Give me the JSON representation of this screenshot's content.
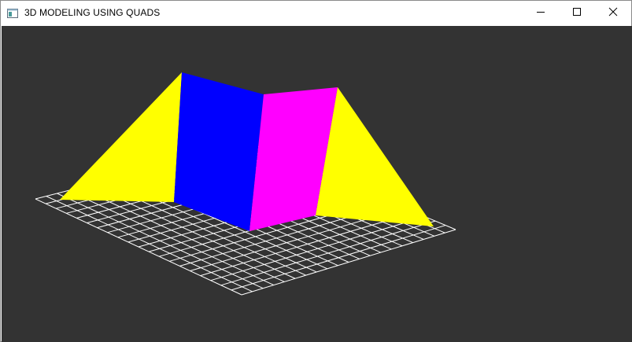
{
  "window": {
    "title": "3D MODELING USING QUADS",
    "icon": "app-window-icon",
    "controls": {
      "minimize": "minimize-icon",
      "maximize": "maximize-icon",
      "close": "close-icon"
    }
  },
  "viewport": {
    "background_color": "#333333",
    "grid": {
      "color": "#ffffff",
      "divisions": 20
    },
    "quads": [
      {
        "name": "left-face",
        "color": "#ffff00"
      },
      {
        "name": "center-left-face",
        "color": "#0000ff"
      },
      {
        "name": "center-right-face",
        "color": "#ff00ff"
      },
      {
        "name": "right-face",
        "color": "#ffff00"
      }
    ]
  }
}
